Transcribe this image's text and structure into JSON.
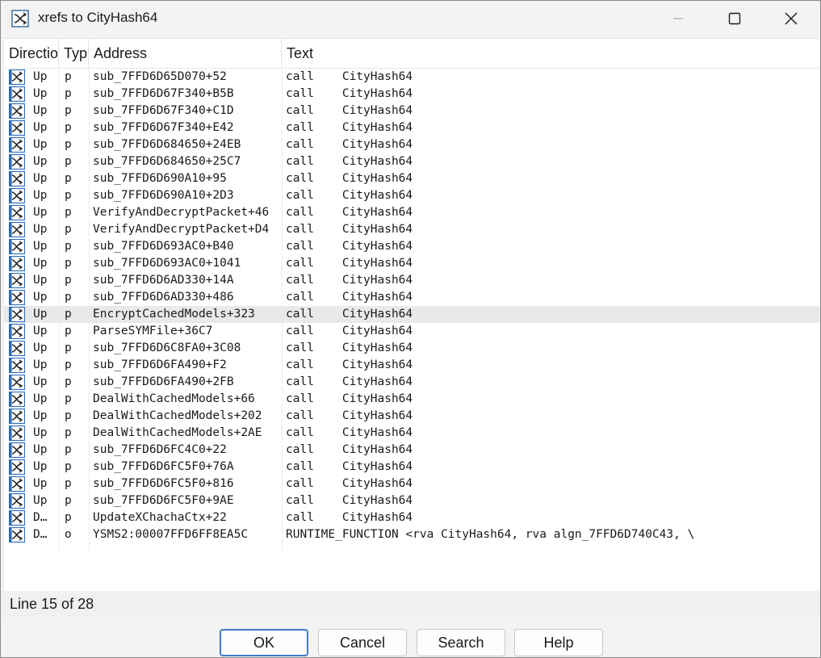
{
  "window": {
    "title": "xrefs to CityHash64"
  },
  "columns": {
    "direction": "Directio",
    "type": "Typ",
    "address": "Address",
    "text": "Text"
  },
  "rows": [
    {
      "dir": "Up",
      "typ": "p",
      "addr": "sub_7FFD6D65D070+52",
      "text": "call    CityHash64"
    },
    {
      "dir": "Up",
      "typ": "p",
      "addr": "sub_7FFD6D67F340+B5B",
      "text": "call    CityHash64"
    },
    {
      "dir": "Up",
      "typ": "p",
      "addr": "sub_7FFD6D67F340+C1D",
      "text": "call    CityHash64"
    },
    {
      "dir": "Up",
      "typ": "p",
      "addr": "sub_7FFD6D67F340+E42",
      "text": "call    CityHash64"
    },
    {
      "dir": "Up",
      "typ": "p",
      "addr": "sub_7FFD6D684650+24EB",
      "text": "call    CityHash64"
    },
    {
      "dir": "Up",
      "typ": "p",
      "addr": "sub_7FFD6D684650+25C7",
      "text": "call    CityHash64"
    },
    {
      "dir": "Up",
      "typ": "p",
      "addr": "sub_7FFD6D690A10+95",
      "text": "call    CityHash64"
    },
    {
      "dir": "Up",
      "typ": "p",
      "addr": "sub_7FFD6D690A10+2D3",
      "text": "call    CityHash64"
    },
    {
      "dir": "Up",
      "typ": "p",
      "addr": "VerifyAndDecryptPacket+46",
      "text": "call    CityHash64"
    },
    {
      "dir": "Up",
      "typ": "p",
      "addr": "VerifyAndDecryptPacket+D4",
      "text": "call    CityHash64"
    },
    {
      "dir": "Up",
      "typ": "p",
      "addr": "sub_7FFD6D693AC0+B40",
      "text": "call    CityHash64"
    },
    {
      "dir": "Up",
      "typ": "p",
      "addr": "sub_7FFD6D693AC0+1041",
      "text": "call    CityHash64"
    },
    {
      "dir": "Up",
      "typ": "p",
      "addr": "sub_7FFD6D6AD330+14A",
      "text": "call    CityHash64"
    },
    {
      "dir": "Up",
      "typ": "p",
      "addr": "sub_7FFD6D6AD330+486",
      "text": "call    CityHash64"
    },
    {
      "dir": "Up",
      "typ": "p",
      "addr": "EncryptCachedModels+323",
      "text": "call    CityHash64",
      "selected": true
    },
    {
      "dir": "Up",
      "typ": "p",
      "addr": "ParseSYMFile+36C7",
      "text": "call    CityHash64"
    },
    {
      "dir": "Up",
      "typ": "p",
      "addr": "sub_7FFD6D6C8FA0+3C08",
      "text": "call    CityHash64"
    },
    {
      "dir": "Up",
      "typ": "p",
      "addr": "sub_7FFD6D6FA490+F2",
      "text": "call    CityHash64"
    },
    {
      "dir": "Up",
      "typ": "p",
      "addr": "sub_7FFD6D6FA490+2FB",
      "text": "call    CityHash64"
    },
    {
      "dir": "Up",
      "typ": "p",
      "addr": "DealWithCachedModels+66",
      "text": "call    CityHash64"
    },
    {
      "dir": "Up",
      "typ": "p",
      "addr": "DealWithCachedModels+202",
      "text": "call    CityHash64"
    },
    {
      "dir": "Up",
      "typ": "p",
      "addr": "DealWithCachedModels+2AE",
      "text": "call    CityHash64"
    },
    {
      "dir": "Up",
      "typ": "p",
      "addr": "sub_7FFD6D6FC4C0+22",
      "text": "call    CityHash64"
    },
    {
      "dir": "Up",
      "typ": "p",
      "addr": "sub_7FFD6D6FC5F0+76A",
      "text": "call    CityHash64"
    },
    {
      "dir": "Up",
      "typ": "p",
      "addr": "sub_7FFD6D6FC5F0+816",
      "text": "call    CityHash64"
    },
    {
      "dir": "Up",
      "typ": "p",
      "addr": "sub_7FFD6D6FC5F0+9AE",
      "text": "call    CityHash64"
    },
    {
      "dir": "D…",
      "typ": "p",
      "addr": "UpdateXChachaCtx+22",
      "text": "call    CityHash64"
    },
    {
      "dir": "D…",
      "typ": "o",
      "addr": "YSMS2:00007FFD6FF8EA5C",
      "text": "RUNTIME_FUNCTION <rva CityHash64, rva algn_7FFD6D740C43, \\"
    }
  ],
  "status": {
    "text": "Line 15 of 28"
  },
  "buttons": {
    "ok": "OK",
    "cancel": "Cancel",
    "search": "Search",
    "help": "Help"
  },
  "colors": {
    "selection": "#e9e9e9",
    "default_button_border": "#3f79c9",
    "icon_blue": "#2b6cb8"
  }
}
